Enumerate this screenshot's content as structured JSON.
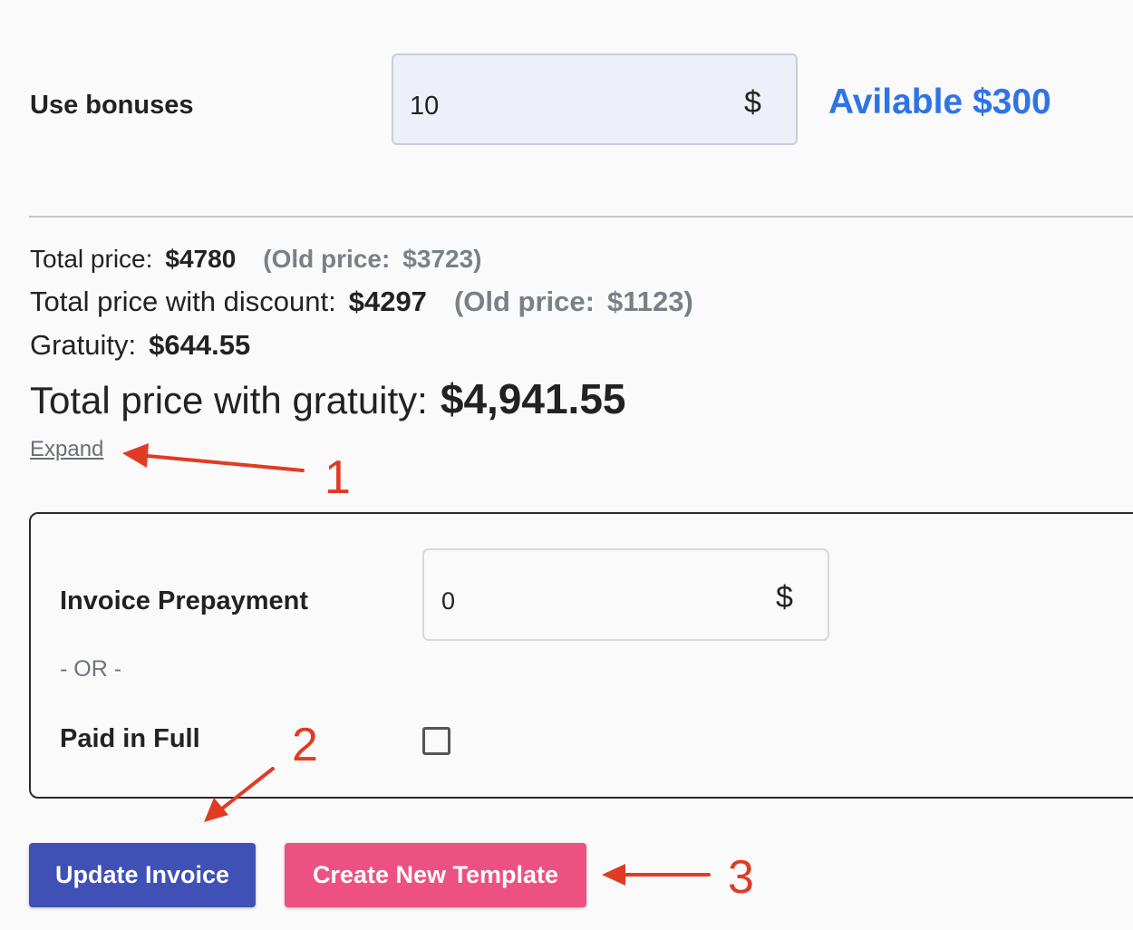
{
  "bonuses": {
    "label": "Use bonuses",
    "value": "10",
    "currency": "$",
    "available": "Avilable $300"
  },
  "totals": {
    "total_label": "Total price:",
    "total_value": "$4780",
    "total_old_label": "(Old price:",
    "total_old_value": "$3723)",
    "discount_label": "Total price with discount:",
    "discount_value": "$4297",
    "discount_old_label": "(Old price:",
    "discount_old_value": "$1123)",
    "gratuity_label": "Gratuity:",
    "gratuity_value": "$644.55",
    "with_gratuity_label": "Total price with gratuity:",
    "with_gratuity_value": "$4,941.55"
  },
  "expand_link": "Expand",
  "invoice": {
    "prepayment_label": "Invoice Prepayment",
    "prepayment_value": "0",
    "currency": "$",
    "or_separator": "- OR -",
    "paid_in_full_label": "Paid in Full",
    "paid_in_full_checked": false
  },
  "buttons": {
    "update_invoice": "Update Invoice",
    "create_template": "Create New Template"
  },
  "annotations": {
    "callout_1": "1",
    "callout_2": "2",
    "callout_3": "3",
    "color": "#e03b23"
  },
  "colors": {
    "primary_button": "#3f51b5",
    "secondary_button": "#ec5181",
    "available_text": "#2f74e6"
  }
}
